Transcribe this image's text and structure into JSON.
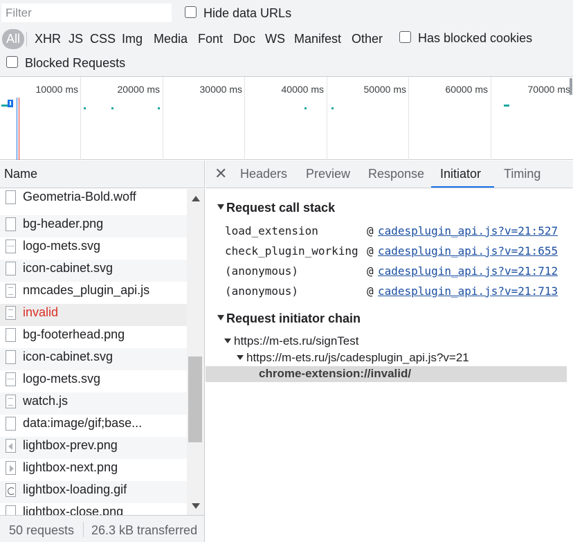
{
  "toolbar": {
    "filter_placeholder": "Filter",
    "hide_data_urls": "Hide data URLs",
    "type_filters": [
      "All",
      "XHR",
      "JS",
      "CSS",
      "Img",
      "Media",
      "Font",
      "Doc",
      "WS",
      "Manifest",
      "Other"
    ],
    "has_blocked_cookies": "Has blocked cookies",
    "blocked_requests": "Blocked Requests"
  },
  "timeline": {
    "labels": [
      "10000 ms",
      "20000 ms",
      "30000 ms",
      "40000 ms",
      "50000 ms",
      "60000 ms",
      "70000 ms"
    ]
  },
  "list": {
    "header": "Name",
    "rows": [
      {
        "name": "Geometria-Bold.woff",
        "icon": "file-icon"
      },
      {
        "name": "bg-header.png",
        "icon": "file-icon"
      },
      {
        "name": "logo-mets.svg",
        "icon": "image-file-icon"
      },
      {
        "name": "icon-cabinet.svg",
        "icon": "file-icon"
      },
      {
        "name": "nmcades_plugin_api.js",
        "icon": "script-file-icon"
      },
      {
        "name": "invalid",
        "icon": "script-file-icon"
      },
      {
        "name": "bg-footerhead.png",
        "icon": "file-icon"
      },
      {
        "name": "icon-cabinet.svg",
        "icon": "file-icon"
      },
      {
        "name": "logo-mets.svg",
        "icon": "image-file-icon"
      },
      {
        "name": "watch.js",
        "icon": "script-file-icon"
      },
      {
        "name": "data:image/gif;base...",
        "icon": "file-icon"
      },
      {
        "name": "lightbox-prev.png",
        "icon": "prev-image-icon"
      },
      {
        "name": "lightbox-next.png",
        "icon": "next-image-icon"
      },
      {
        "name": "lightbox-loading.gif",
        "icon": "loading-gif-icon"
      },
      {
        "name": "lightbox-close.png",
        "icon": "file-icon"
      }
    ]
  },
  "status": {
    "requests": "50 requests",
    "transferred": "26.3 kB transferred"
  },
  "panel": {
    "close_glyph": "✕",
    "tabs": [
      "Headers",
      "Preview",
      "Response",
      "Initiator",
      "Timing"
    ],
    "active_tab": "Initiator",
    "call_stack_title": "Request call stack",
    "call_stack": [
      {
        "fn": "load_extension",
        "at": "@",
        "link": "cadesplugin_api.js?v=21:527"
      },
      {
        "fn": "check_plugin_working",
        "at": "@",
        "link": "cadesplugin_api.js?v=21:655"
      },
      {
        "fn": "(anonymous)",
        "at": "@",
        "link": "cadesplugin_api.js?v=21:712"
      },
      {
        "fn": "(anonymous)",
        "at": "@",
        "link": "cadesplugin_api.js?v=21:713"
      }
    ],
    "chain_title": "Request initiator chain",
    "chain": [
      "https://m-ets.ru/signTest",
      "https://m-ets.ru/js/cadesplugin_api.js?v=21",
      "chrome-extension://invalid/"
    ]
  },
  "colors": {
    "accent": "#1a73e8",
    "error": "#d93025",
    "link": "#1a4ea0",
    "timeline_bar": "#1fa8a0"
  }
}
